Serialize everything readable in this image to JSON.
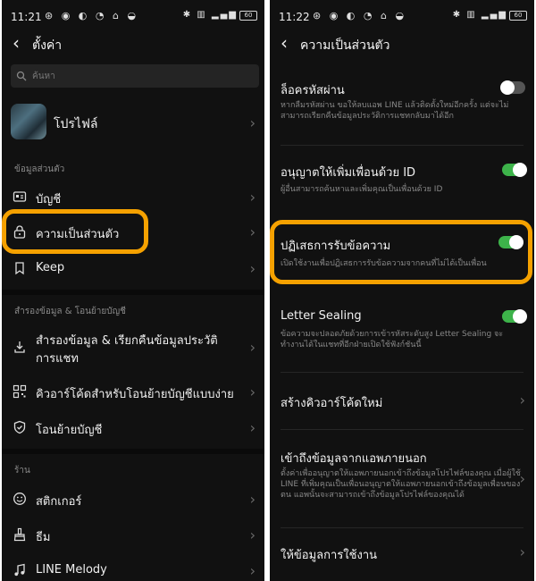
{
  "left": {
    "status": {
      "time": "11:21",
      "battery": "60"
    },
    "header": {
      "title": "ตั้งค่า"
    },
    "search": {
      "placeholder": "ค้นหา"
    },
    "profile": {
      "label": "โปรไฟล์"
    },
    "sections": {
      "personal": "ข้อมูลส่วนตัว",
      "backup": "สำรองข้อมูล & โอนย้ายบัญชี",
      "shop": "ร้าน"
    },
    "items": {
      "account": "บัญชี",
      "privacy": "ความเป็นส่วนตัว",
      "keep": "Keep",
      "backup": "สำรองข้อมูล & เรียกคืนข้อมูลประวัติการแชท",
      "qr": "คิวอาร์โค้ดสำหรับโอนย้ายบัญชีแบบง่าย",
      "transfer": "โอนย้ายบัญชี",
      "sticker": "สติกเกอร์",
      "theme": "ธีม",
      "melody": "LINE Melody"
    }
  },
  "right": {
    "status": {
      "time": "11:22",
      "battery": "60"
    },
    "header": {
      "title": "ความเป็นส่วนตัว"
    },
    "settings": [
      {
        "title": "ล็อครหัสผ่าน",
        "desc": "หากลืมรหัสผ่าน ขอให้ลบแอพ LINE แล้วติดตั้งใหม่อีกครั้ง แต่จะไม่สามารถเรียกคืนข้อมูลประวัติการแชทกลับมาได้อีก",
        "on": false
      },
      {
        "title": "อนุญาตให้เพิ่มเพื่อนด้วย ID",
        "desc": "ผู้อื่นสามารถค้นหาและเพิ่มคุณเป็นเพื่อนด้วย ID",
        "on": true
      },
      {
        "title": "ปฏิเสธการรับข้อความ",
        "desc": "เปิดใช้งานเพื่อปฏิเสธการรับข้อความจากคนที่ไม่ได้เป็นเพื่อน",
        "on": true
      },
      {
        "title": "Letter Sealing",
        "desc": "ข้อความจะปลอดภัยด้วยการเข้ารหัสระดับสูง Letter Sealing จะทำงานได้ในแชทที่อีกฝ่ายเปิดใช้ฟังก์ชันนี้",
        "on": true
      }
    ],
    "links": {
      "create_qr": "สร้างคิวอาร์โค้ดใหม่",
      "external": "เข้าถึงข้อมูลจากแอพภายนอก",
      "external_desc": "ตั้งค่าเพื่ออนุญาตให้แอพภายนอกเข้าถึงข้อมูลโปรไฟล์ของคุณ เมื่อผู้ใช้ LINE ที่เพิ่มคุณเป็นเพื่อนอนุญาตให้แอพภายนอกเข้าถึงข้อมูลเพื่อนของตน แอพนั้นจะสามารถเข้าถึงข้อมูลโปรไฟล์ของคุณได้",
      "usage": "ให้ข้อมูลการใช้งาน"
    }
  },
  "colors": {
    "highlight": "#f5a100",
    "toggle_on": "#3db34a",
    "background": "#111111"
  }
}
